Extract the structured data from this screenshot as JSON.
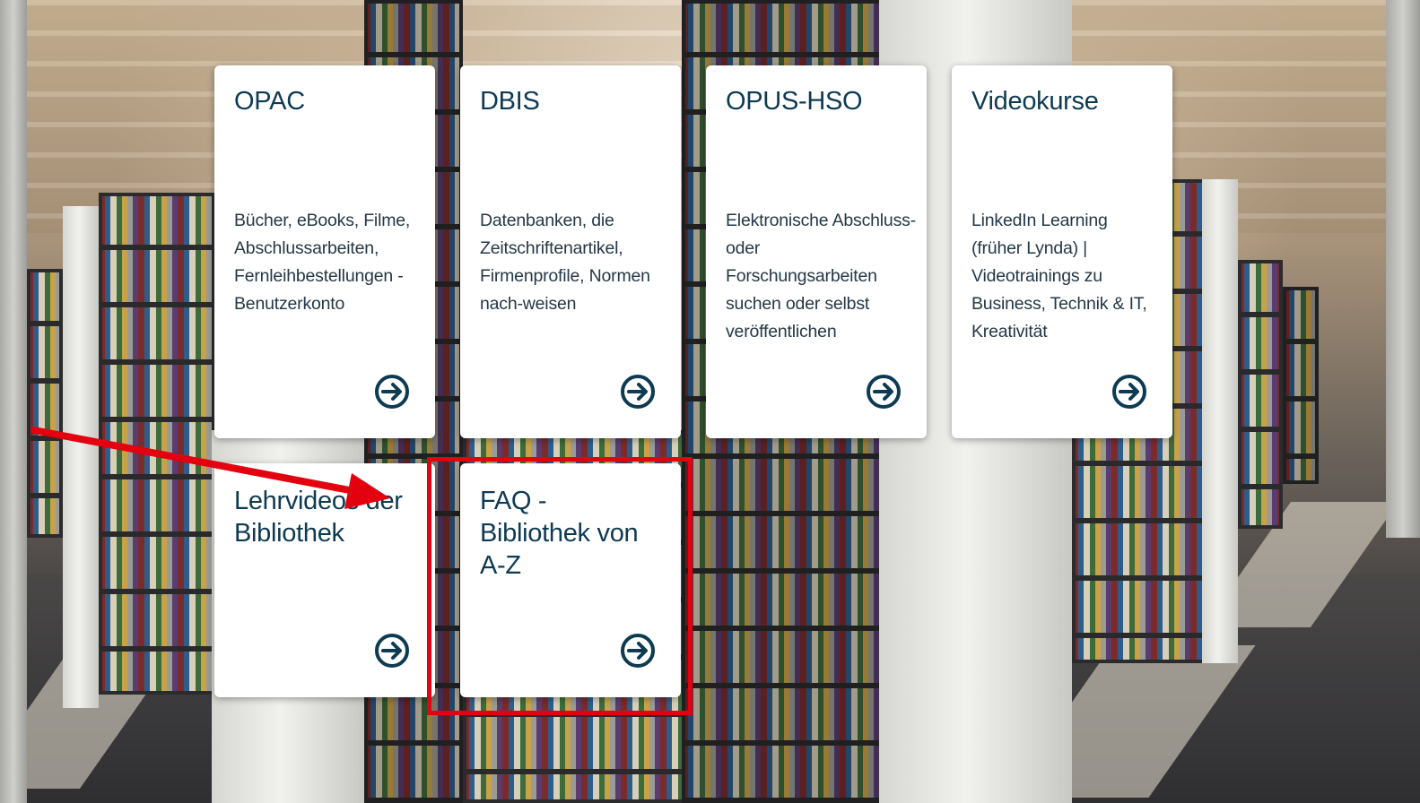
{
  "cards": [
    {
      "title": "OPAC",
      "desc": "Bücher, eBooks, Filme, Abschlussarbeiten, Fernleihbestellungen - Benutzerkonto",
      "arrow_icon": "arrow-circle-right-icon"
    },
    {
      "title": "DBIS",
      "desc": "Datenbanken, die Zeitschriftenartikel, Firmenprofile, Normen nach-weisen",
      "arrow_icon": "arrow-circle-right-icon"
    },
    {
      "title": "OPUS-HSO",
      "desc": "Elektronische Abschluss- oder Forschungsarbeiten suchen oder selbst veröffentlichen",
      "arrow_icon": "arrow-circle-right-icon"
    },
    {
      "title": "Videokurse",
      "desc": "LinkedIn Learning (früher Lynda) | Videotrainings zu Business, Technik & IT, Kreativität",
      "arrow_icon": "arrow-circle-right-icon"
    },
    {
      "title": "Lehrvideos der Bibliothek",
      "desc": "",
      "arrow_icon": "arrow-circle-right-icon"
    },
    {
      "title": "FAQ - Bibliothek von A-Z",
      "desc": "",
      "arrow_icon": "arrow-circle-right-icon"
    }
  ],
  "colors": {
    "title": "#0e3a52",
    "text": "#243847",
    "icon": "#0e3a52",
    "highlight": "#e3000f"
  }
}
